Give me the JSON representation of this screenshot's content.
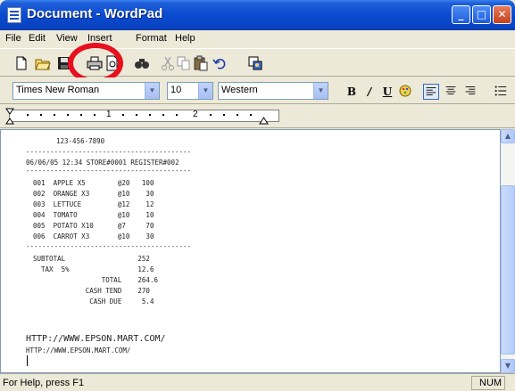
{
  "window": {
    "title": "Document - WordPad"
  },
  "titlebar_buttons": {
    "minimize": "_",
    "maximize": "□",
    "close": "✕"
  },
  "menu": [
    "File",
    "Edit",
    "View",
    "Insert",
    "Format",
    "Help"
  ],
  "toolbar": {
    "icons": [
      "new-document",
      "open-folder",
      "save",
      "print",
      "print-preview",
      "find",
      "cut",
      "copy",
      "paste",
      "undo",
      "insert-object"
    ]
  },
  "format": {
    "font": "Times New Roman",
    "size": "10",
    "script": "Western",
    "bold": "B",
    "italic": "/",
    "underline": "U"
  },
  "ruler": {
    "marks": [
      "1",
      "2"
    ]
  },
  "document": {
    "lines": [
      "123-456-7890",
      "-----------------------------------------",
      "06/06/05 12:34 STORE#0001 REGISTER#002",
      "-----------------------------------------",
      "001  APPLE X5        @20   100",
      "002  ORANGE X3       @10    30",
      "003  LETTUCE         @12    12",
      "004  TOMATO          @10    10",
      "005  POTATO X10      @7     70",
      "006  CARROT X3       @10    30",
      "-----------------------------------------",
      "SUBTOTAL                  252",
      "  TAX  5%                 12.6",
      "                 TOTAL    264.6",
      "             CASH TEND    270",
      "              CASH DUE     5.4",
      "HTTP://WWW.EPSON.MART.COM/",
      "HTTP://WWW.EPSON.MART.COM/"
    ]
  },
  "status": {
    "help": "For Help, press F1",
    "num": "NUM"
  },
  "colors": {
    "highlight_ring": "#e8101e",
    "titlebar": "#0a4bd0"
  }
}
